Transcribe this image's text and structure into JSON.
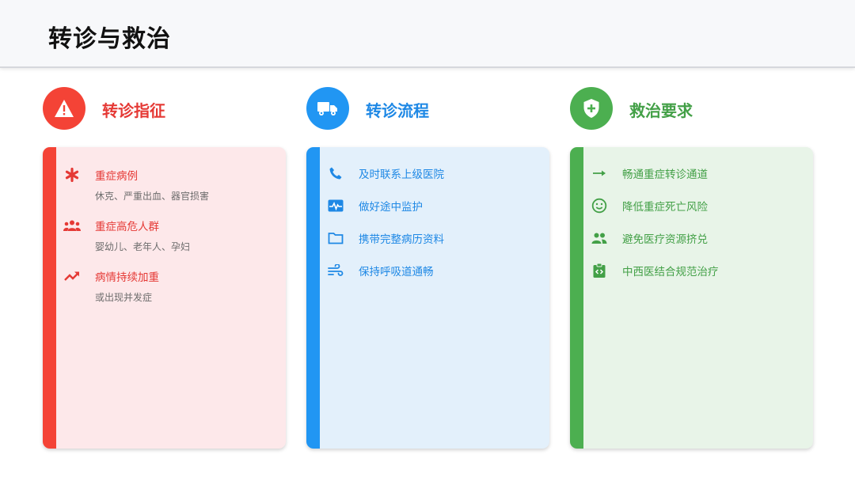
{
  "page": {
    "title": "转诊与救治"
  },
  "colors": {
    "red": "#f44336",
    "blue": "#2196f3",
    "green": "#4caf50"
  },
  "columns": [
    {
      "title": "转诊指征",
      "icon": "warning-icon",
      "items": [
        {
          "icon": "asterisk-icon",
          "title": "重症病例",
          "subtitle": "休克、严重出血、器官损害"
        },
        {
          "icon": "people-group-icon",
          "title": "重症高危人群",
          "subtitle": "婴幼儿、老年人、孕妇"
        },
        {
          "icon": "trending-up-icon",
          "title": "病情持续加重",
          "subtitle": "或出现并发症"
        }
      ]
    },
    {
      "title": "转诊流程",
      "icon": "truck-icon",
      "items": [
        {
          "icon": "phone-icon",
          "title": "及时联系上级医院"
        },
        {
          "icon": "monitor-heart-icon",
          "title": "做好途中监护"
        },
        {
          "icon": "folder-icon",
          "title": "携带完整病历资料"
        },
        {
          "icon": "air-icon",
          "title": "保持呼吸道通畅"
        }
      ]
    },
    {
      "title": "救治要求",
      "icon": "shield-plus-icon",
      "items": [
        {
          "icon": "arrow-right-icon",
          "title": "畅通重症转诊通道"
        },
        {
          "icon": "smile-icon",
          "title": "降低重症死亡风险"
        },
        {
          "icon": "people-icon",
          "title": "避免医疗资源挤兑"
        },
        {
          "icon": "clipboard-code-icon",
          "title": "中西医结合规范治疗"
        }
      ]
    }
  ]
}
